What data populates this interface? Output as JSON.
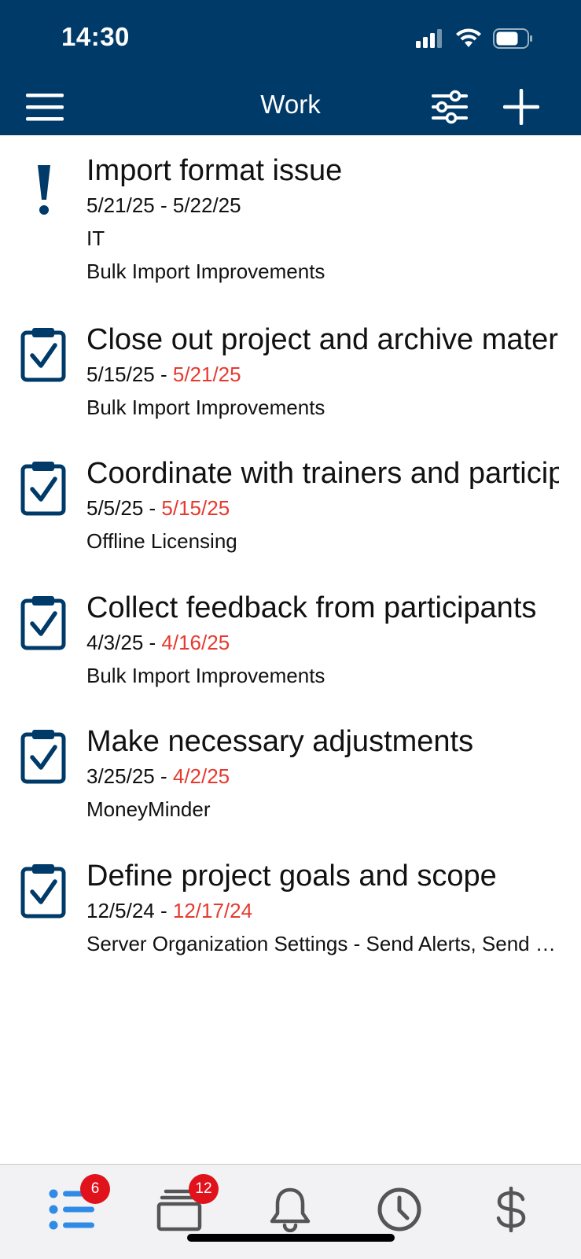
{
  "status_bar": {
    "time": "14:30"
  },
  "nav": {
    "title": "Work"
  },
  "items": [
    {
      "kind": "issue",
      "title": "Import format issue",
      "date_start": "5/21/25",
      "date_sep": " - ",
      "date_end": "5/22/25",
      "overdue": false,
      "line1": "IT",
      "line2": "Bulk Import Improvements"
    },
    {
      "kind": "task",
      "title": "Close out project and archive materials",
      "date_start": "5/15/25",
      "date_sep": " - ",
      "date_end": "5/21/25",
      "overdue": true,
      "line1": "Bulk Import Improvements"
    },
    {
      "kind": "task",
      "title": "Coordinate with trainers and participants",
      "date_start": "5/5/25",
      "date_sep": " - ",
      "date_end": "5/15/25",
      "overdue": true,
      "line1": "Offline Licensing"
    },
    {
      "kind": "task",
      "title": "Collect feedback from participants",
      "date_start": "4/3/25",
      "date_sep": " - ",
      "date_end": "4/16/25",
      "overdue": true,
      "line1": "Bulk Import Improvements"
    },
    {
      "kind": "task",
      "title": "Make necessary adjustments",
      "date_start": "3/25/25",
      "date_sep": " - ",
      "date_end": "4/2/25",
      "overdue": true,
      "line1": "MoneyMinder"
    },
    {
      "kind": "task",
      "title": "Define project goals and scope",
      "date_start": "12/5/24",
      "date_sep": " - ",
      "date_end": "12/17/24",
      "overdue": true,
      "line1": "Server Organization Settings - Send Alerts, Send Emails"
    }
  ],
  "tabs": {
    "list_badge": "6",
    "cards_badge": "12"
  },
  "colors": {
    "brand": "#003a68",
    "overdue": "#e63a30",
    "active_tab": "#2f8be6",
    "inactive_tab": "#555555"
  }
}
